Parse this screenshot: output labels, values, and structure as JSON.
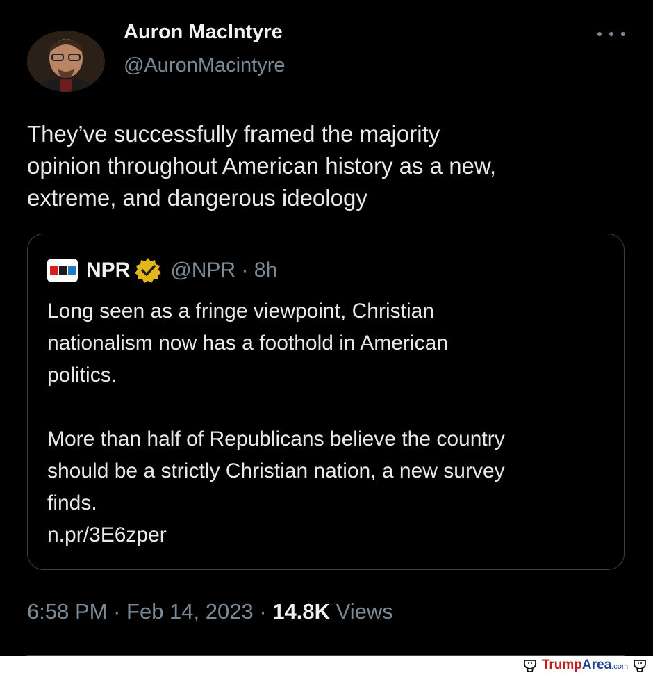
{
  "tweet": {
    "author_name": "Auron MacIntyre",
    "author_handle": "@AuronMacintyre",
    "text": "They’ve successfully framed the majority\nopinion throughout American history as a new,\nextreme, and dangerous ideology",
    "time": "6:58 PM",
    "sep1": "·",
    "date": "Feb 14, 2023",
    "sep2": "·",
    "views_count": "14.8K",
    "views_label": "Views"
  },
  "quote": {
    "name": "NPR",
    "handle_time": "@NPR · 8h",
    "logo_letters": "npr",
    "text": "Long seen as a fringe viewpoint, Christian\nnationalism now has a foothold in American\npolitics.\n\nMore than half of Republicans believe the country\nshould be a strictly Christian nation, a new survey\nfinds.\nn.pr/3E6zper"
  },
  "watermark": {
    "part1": "Trump",
    "part2": "Area",
    "part3": ".com"
  },
  "icons": {
    "more": "more-horizontal-icon",
    "verified": "verified-badge-icon",
    "npr_logo": "npr-logo-icon",
    "toilet": "toilet-icon"
  },
  "colors": {
    "background": "#000000",
    "text": "#e7e9ea",
    "secondary": "#7c8a96",
    "verified_gold": "#e2b719",
    "npr_red": "#d62021",
    "npr_black": "#1b1b1b",
    "npr_blue": "#237bbd"
  }
}
